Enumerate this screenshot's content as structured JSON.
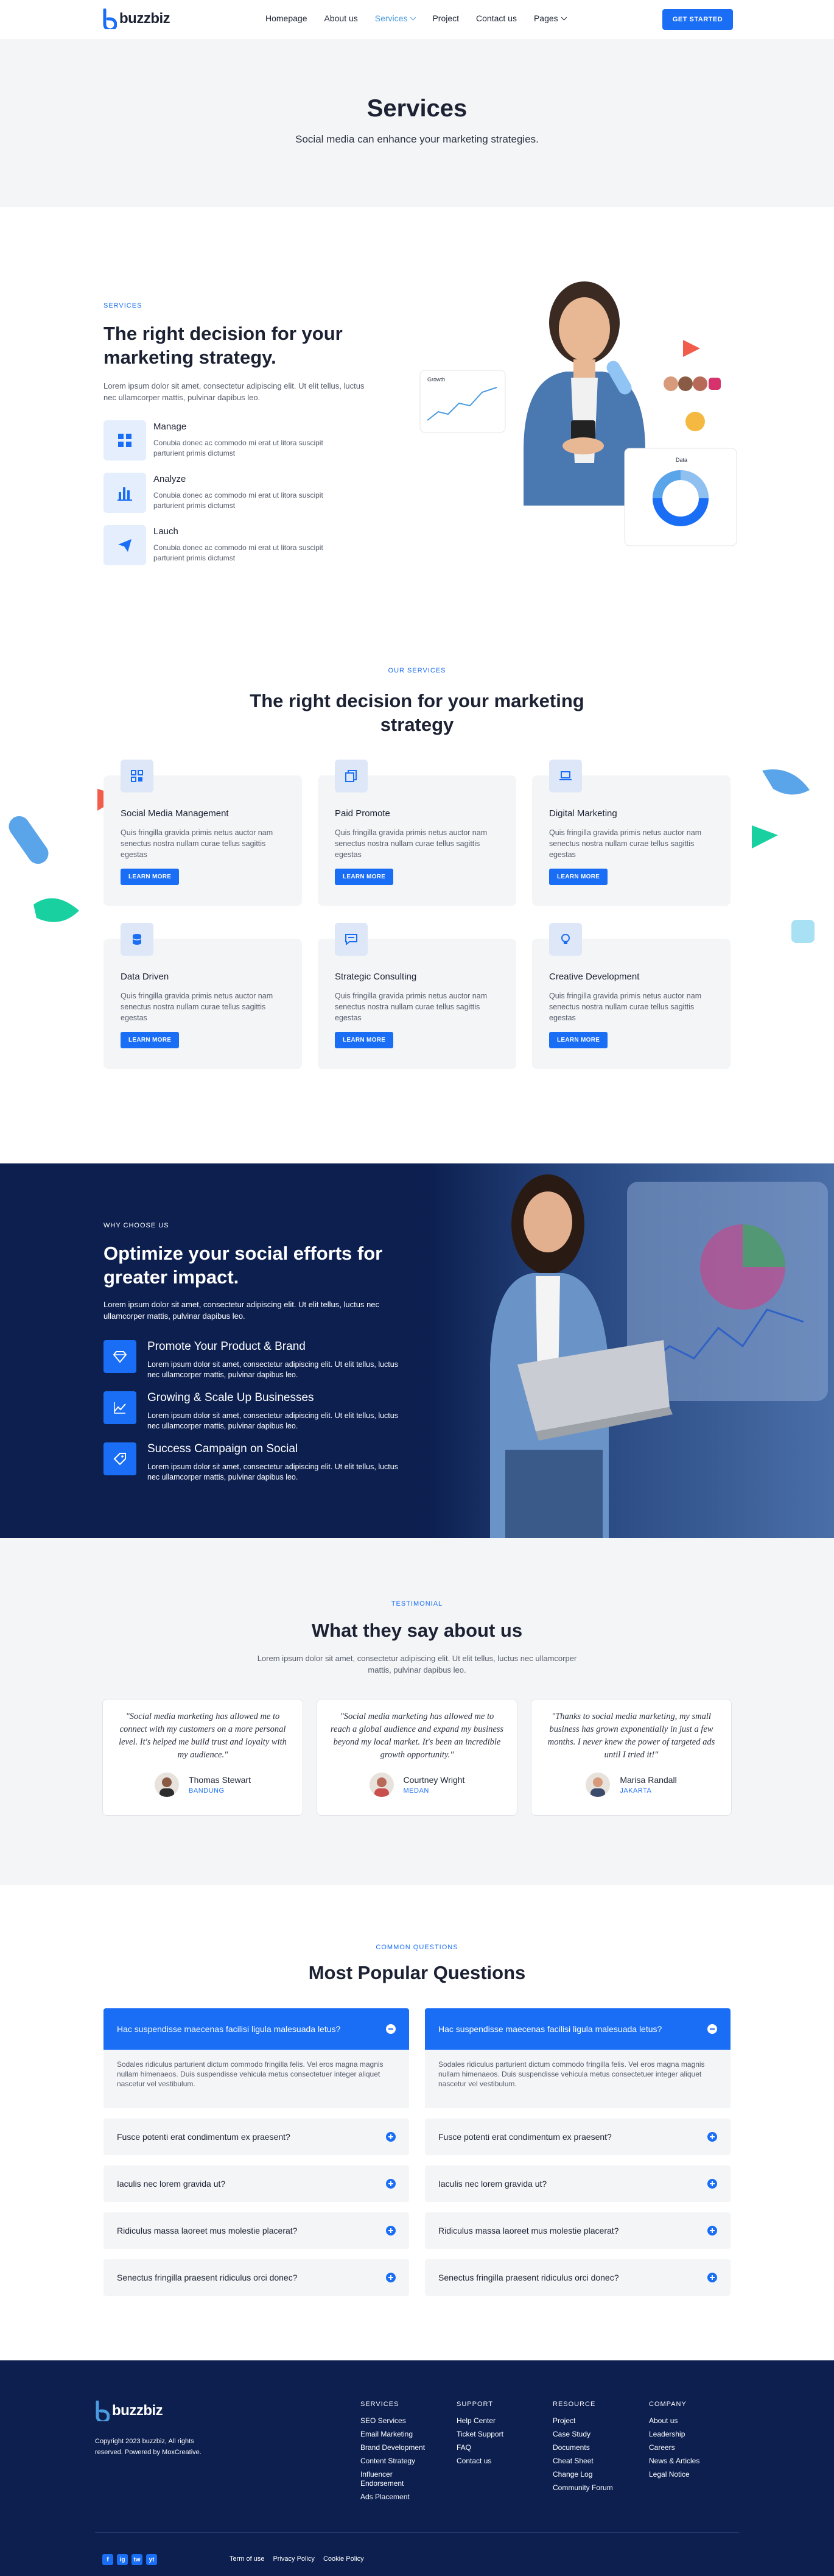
{
  "header": {
    "logo_text": "buzzbiz",
    "nav": [
      {
        "label": "Homepage"
      },
      {
        "label": "About us"
      },
      {
        "label": "Services",
        "active": true,
        "dropdown": true
      },
      {
        "label": "Project"
      },
      {
        "label": "Contact us"
      },
      {
        "label": "Pages",
        "dropdown": true
      }
    ],
    "cta": "GET STARTED"
  },
  "hero": {
    "title": "Services",
    "subtitle": "Social media can enhance your marketing strategies."
  },
  "intro": {
    "eyebrow": "SERVICES",
    "title": "The right decision for your marketing strategy.",
    "lead": "Lorem ipsum dolor sit amet, consectetur adipiscing elit. Ut elit tellus, luctus nec ullamcorper mattis, pulvinar dapibus leo.",
    "features": [
      {
        "title": "Manage",
        "text": "Conubia donec ac commodo mi erat ut litora suscipit parturient primis dictumst",
        "icon": "grid-icon"
      },
      {
        "title": "Analyze",
        "text": "Conubia donec ac commodo mi erat ut litora suscipit parturient primis dictumst",
        "icon": "bar-chart-icon"
      },
      {
        "title": "Lauch",
        "text": "Conubia donec ac commodo mi erat ut litora suscipit parturient primis dictumst",
        "icon": "paper-plane-icon"
      }
    ],
    "chart_card_title": "Growth",
    "donut_card_title": "Data"
  },
  "services": {
    "eyebrow": "OUR SERVICES",
    "title": "The right decision for your marketing strategy",
    "cards": [
      {
        "title": "Social Media Management",
        "text": "Quis fringilla gravida primis netus auctor nam senectus nostra nullam curae tellus sagittis egestas",
        "button": "LEARN MORE",
        "icon": "dashboard-icon"
      },
      {
        "title": "Paid Promote",
        "text": "Quis fringilla gravida primis netus auctor nam senectus nostra nullam curae tellus sagittis egestas",
        "button": "LEARN MORE",
        "icon": "copy-icon"
      },
      {
        "title": "Digital Marketing",
        "text": "Quis fringilla gravida primis netus auctor nam senectus nostra nullam curae tellus sagittis egestas",
        "button": "LEARN MORE",
        "icon": "laptop-icon"
      },
      {
        "title": "Data Driven",
        "text": "Quis fringilla gravida primis netus auctor nam senectus nostra nullam curae tellus sagittis egestas",
        "button": "LEARN MORE",
        "icon": "database-icon"
      },
      {
        "title": "Strategic Consulting",
        "text": "Quis fringilla gravida primis netus auctor nam senectus nostra nullam curae tellus sagittis egestas",
        "button": "LEARN MORE",
        "icon": "chat-icon"
      },
      {
        "title": "Creative Development",
        "text": "Quis fringilla gravida primis netus auctor nam senectus nostra nullam curae tellus sagittis egestas",
        "button": "LEARN MORE",
        "icon": "lightbulb-icon"
      }
    ]
  },
  "why": {
    "eyebrow": "WHY CHOOSE US",
    "title": "Optimize your social efforts for greater impact.",
    "lead": "Lorem ipsum dolor sit amet, consectetur adipiscing elit. Ut elit tellus, luctus nec ullamcorper mattis, pulvinar dapibus leo.",
    "features": [
      {
        "title": "Promote Your Product & Brand",
        "text": "Lorem ipsum dolor sit amet, consectetur adipiscing elit. Ut elit tellus, luctus nec ullamcorper mattis, pulvinar dapibus leo.",
        "icon": "diamond-icon"
      },
      {
        "title": "Growing & Scale Up Businesses",
        "text": "Lorem ipsum dolor sit amet, consectetur adipiscing elit. Ut elit tellus, luctus nec ullamcorper mattis, pulvinar dapibus leo.",
        "icon": "trend-line-icon"
      },
      {
        "title": "Success Campaign on Social",
        "text": "Lorem ipsum dolor sit amet, consectetur adipiscing elit. Ut elit tellus, luctus nec ullamcorper mattis, pulvinar dapibus leo.",
        "icon": "tag-icon"
      }
    ]
  },
  "testimonials": {
    "eyebrow": "TESTIMONIAL",
    "title": "What they say about us",
    "lead": "Lorem ipsum dolor sit amet, consectetur adipiscing elit. Ut elit tellus, luctus nec ullamcorper mattis, pulvinar dapibus leo.",
    "items": [
      {
        "quote": "\"Social media marketing has allowed me to connect with my customers on a more personal level. It's helped me build trust and loyalty with my audience.\"",
        "name": "Thomas Stewart",
        "city": "BANDUNG"
      },
      {
        "quote": "\"Social media marketing has allowed me to reach a global audience and expand my business beyond my local market. It's been an incredible growth opportunity.\"",
        "name": "Courtney Wright",
        "city": "MEDAN"
      },
      {
        "quote": "\"Thanks to social media marketing, my small business has grown exponentially in just a few months. I never knew the power of targeted ads until I tried it!\"",
        "name": "Marisa Randall",
        "city": "JAKARTA"
      }
    ]
  },
  "faq": {
    "eyebrow": "COMMON QUESTIONS",
    "title": "Most Popular Questions",
    "open_question": "Hac suspendisse maecenas facilisi ligula malesuada letus?",
    "open_answer": "Sodales ridiculus parturient dictum commodo fringilla felis. Vel eros magna magnis nullam himenaeos. Duis suspendisse vehicula metus consectetuer integer aliquet nascetur vel vestibulum.",
    "questions": [
      "Fusce potenti erat condimentum ex praesent?",
      "Iaculis nec lorem gravida ut?",
      "Ridiculus massa laoreet mus molestie placerat?",
      "Senectus fringilla praesent ridiculus orci donec?"
    ]
  },
  "footer": {
    "logo_text": "buzzbiz",
    "copyright": "Copyright 2023 buzzbiz, All rights reserved. Powered by MoxCreative.",
    "columns": [
      {
        "title": "SERVICES",
        "links": [
          "SEO Services",
          "Email Marketing",
          "Brand Development",
          "Content Strategy",
          "Influencer Endorsement",
          "Ads Placement"
        ]
      },
      {
        "title": "SUPPORT",
        "links": [
          "Help Center",
          "Ticket Support",
          "FAQ",
          "Contact us"
        ]
      },
      {
        "title": "RESOURCE",
        "links": [
          "Project",
          "Case Study",
          "Documents",
          "Cheat Sheet",
          "Change Log",
          "Community Forum"
        ]
      },
      {
        "title": "COMPANY",
        "links": [
          "About us",
          "Leadership",
          "Careers",
          "News & Articles",
          "Legal Notice"
        ]
      }
    ],
    "social": [
      "f",
      "ig",
      "tw",
      "yt"
    ],
    "legal": [
      "Term of use",
      "Privacy Policy",
      "Cookie Policy"
    ]
  },
  "colors": {
    "accent": "#1a6ef5",
    "navy": "#0c1f4f",
    "light": "#f4f5f7"
  }
}
